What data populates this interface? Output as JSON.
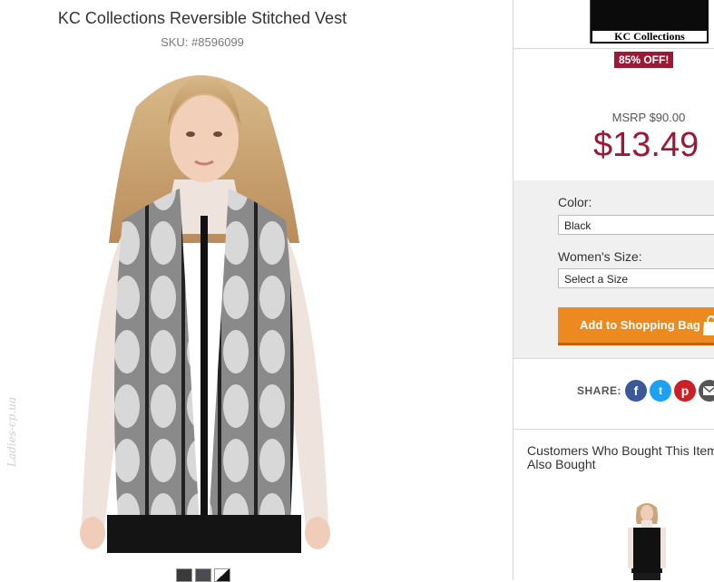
{
  "product": {
    "title": "KC Collections Reversible Stitched Vest",
    "sku": "SKU: #8596099",
    "image_alt": "model-wearing-vest"
  },
  "swatches": [
    "charcoal",
    "slate",
    "black-white"
  ],
  "watermark": "Ladies-cp.ua",
  "brand": {
    "logo_text": "KC Collections"
  },
  "discount_badge": "85% OFF!",
  "pricing": {
    "msrp": "MSRP $90.00",
    "price": "$13.49"
  },
  "options": {
    "color_label": "Color:",
    "color_value": "Black",
    "size_label": "Women's Size:",
    "size_value": "Select a Size"
  },
  "add_to_bag_label": "Add to Shopping Bag",
  "share": {
    "label": "SHARE:",
    "networks": [
      "facebook-icon",
      "twitter-icon",
      "pinterest-icon",
      "email-icon"
    ]
  },
  "customers_heading": "Customers Who Bought This Item Also Bought",
  "colors": {
    "price": "#9b1837",
    "badge": "#9b1837",
    "button": "#ed8a1f",
    "facebook": "#3b5998",
    "twitter": "#1da1f2",
    "pinterest": "#cb2027",
    "email": "#555555"
  }
}
